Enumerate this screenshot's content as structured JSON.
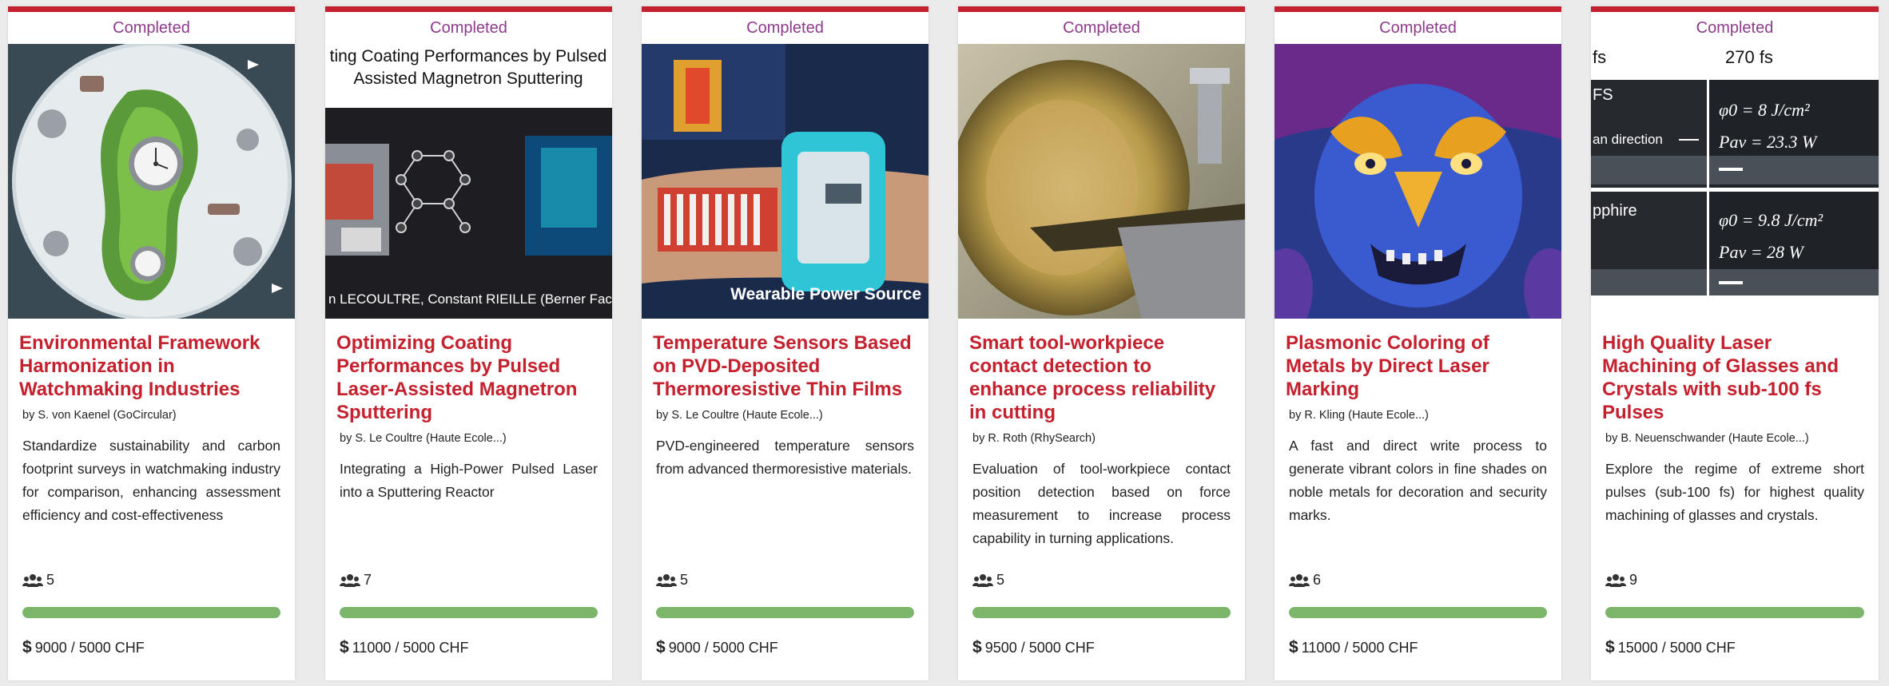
{
  "cards": [
    {
      "status": "Completed",
      "title": "Environmental Framework Harmonization in Watchmaking Industries",
      "author": "by S. von Kaenel (GoCircular)",
      "description": "Standardize sustainability and carbon footprint surveys in watchmaking industry for comparison, enhancing assessment efficiency and cost-effectiveness",
      "members": "5",
      "funding": "9000 / 5000 CHF",
      "progress_percent": 100
    },
    {
      "status": "Completed",
      "title": "Optimizing Coating Performances by Pulsed Laser-Assisted Magnetron Sputtering",
      "author": "by S. Le Coultre (Haute Ecole...)",
      "description": "Integrating a High-Power Pulsed Laser into a Sputtering Reactor",
      "members": "7",
      "funding": "11000 / 5000 CHF",
      "progress_percent": 100,
      "image_text": {
        "top_line1": "ting Coating Performances by Pulsed",
        "top_line2": "Assisted Magnetron Sputtering",
        "bottom": "n LECOULTRE, Constant RIEILLE (Berner Fachhochsc"
      }
    },
    {
      "status": "Completed",
      "title": "Temperature Sensors Based on PVD-Deposited Thermoresistive Thin Films",
      "author": "by S. Le Coultre (Haute Ecole...)",
      "description": "PVD-engineered temperature sensors from advanced thermoresistive materials.",
      "members": "5",
      "funding": "9000 / 5000 CHF",
      "progress_percent": 100,
      "image_text": {
        "caption": "Wearable Power Source"
      }
    },
    {
      "status": "Completed",
      "title": "Smart tool-workpiece contact detection to enhance process reliability in cutting",
      "author": "by R. Roth (RhySearch)",
      "description": "Evaluation of tool-workpiece contact position detection based on force measurement to increase process capability in turning applications.",
      "members": "5",
      "funding": "9500 / 5000 CHF",
      "progress_percent": 100
    },
    {
      "status": "Completed",
      "title": "Plasmonic Coloring of Metals by Direct Laser Marking",
      "author": "by R. Kling (Haute Ecole...)",
      "description": "A fast and direct write process to generate vibrant colors in fine shades on noble metals for decoration and security marks.",
      "members": "6",
      "funding": "11000 / 5000 CHF",
      "progress_percent": 100
    },
    {
      "status": "Completed",
      "title": "High Quality Laser Machining of Glasses and Crystals with sub-100 fs Pulses",
      "author": "by B. Neuenschwander (Haute Ecole...)",
      "description": "Explore the regime of extreme short pulses (sub-100 fs) for highest quality machining of glasses and crystals.",
      "members": "9",
      "funding": "15000 / 5000 CHF",
      "progress_percent": 100,
      "image_text": {
        "fs_left": "fs",
        "fs_right": "270 fs",
        "fs_label": "FS",
        "scan": "an direction",
        "sapphire": "pphire",
        "phi1": "φ0 = 8 J/cm²",
        "pav1": "Pav = 23.3 W",
        "phi2": "φ0 = 9.8 J/cm²",
        "pav2": "Pav = 28 W"
      }
    }
  ],
  "colors": {
    "accent": "#c5202d",
    "status": "#8e3a8a",
    "progress": "#7cb66b"
  }
}
